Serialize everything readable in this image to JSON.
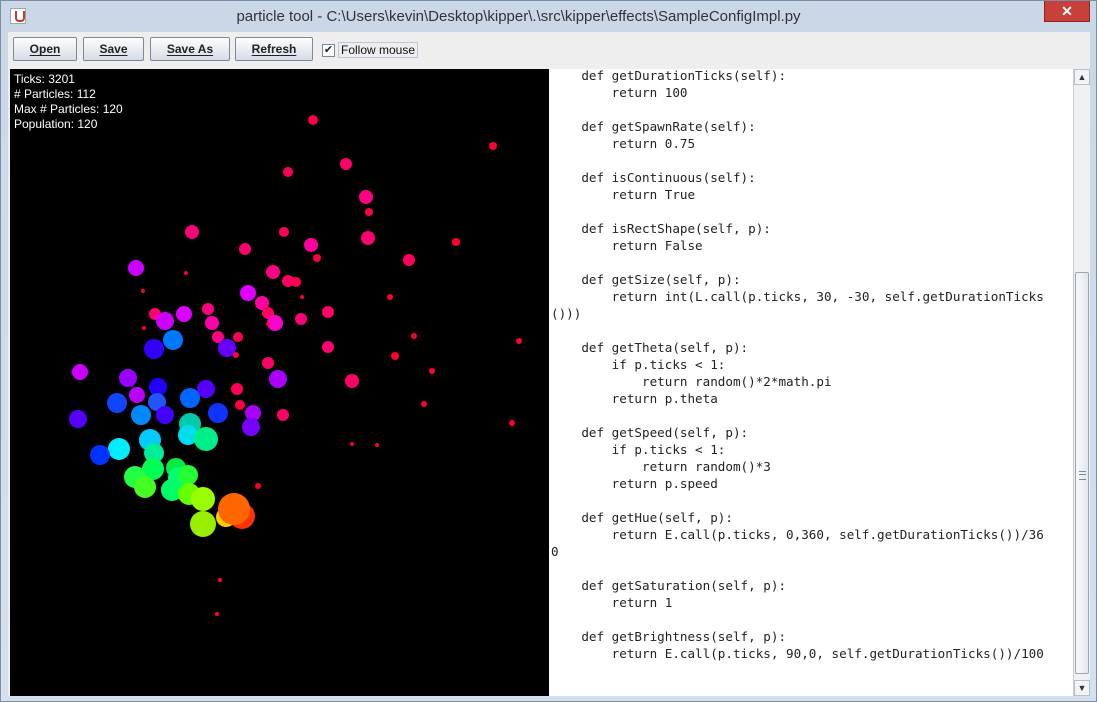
{
  "window": {
    "title": "particle tool - C:\\Users\\kevin\\Desktop\\kipper\\.\\src\\kipper\\effects\\SampleConfigImpl.py",
    "close_label": "✕"
  },
  "toolbar": {
    "open_label": "Open",
    "save_label": "Save",
    "save_as_label": "Save As",
    "refresh_label": "Refresh",
    "follow_mouse_label": "Follow mouse",
    "follow_mouse_checked": "✔"
  },
  "stats": {
    "ticks": "Ticks: 3201",
    "particles": "# Particles: 112",
    "max_particles": "Max # Particles: 120",
    "population": "Population: 120"
  },
  "editor": {
    "lines": [
      "    def getDurationTicks(self):",
      "        return 100",
      "",
      "    def getSpawnRate(self):",
      "        return 0.75",
      "",
      "    def isContinuous(self):",
      "        return True",
      "",
      "    def isRectShape(self, p):",
      "        return False",
      "",
      "    def getSize(self, p):",
      "        return int(L.call(p.ticks, 30, -30, self.getDurationTicks",
      "()))",
      "",
      "    def getTheta(self, p):",
      "        if p.ticks < 1:",
      "            return random()*2*math.pi",
      "        return p.theta",
      "",
      "    def getSpeed(self, p):",
      "        if p.ticks < 1:",
      "            return random()*3",
      "        return p.speed",
      "",
      "    def getHue(self, p):",
      "        return E.call(p.ticks, 0,360, self.getDurationTicks())/36",
      "0",
      "",
      "    def getSaturation(self, p):",
      "        return 1",
      "",
      "    def getBrightness(self, p):",
      "        return E.call(p.ticks, 90,0, self.getDurationTicks())/100"
    ]
  },
  "scrollbar": {
    "up_icon": "▲",
    "down_icon": "▼"
  }
}
